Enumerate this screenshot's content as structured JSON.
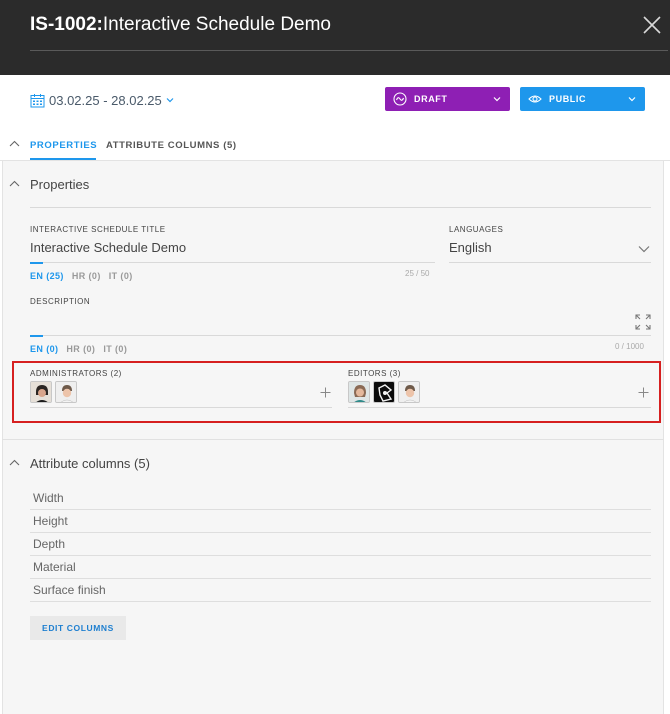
{
  "header": {
    "code": "IS-1002:",
    "title": "Interactive Schedule Demo"
  },
  "date_range": "03.02.25 - 28.02.25",
  "status_pill": {
    "label": "DRAFT",
    "color": "#8e1fb4"
  },
  "visibility_pill": {
    "label": "PUBLIC",
    "color": "#1e97ec"
  },
  "tabs": [
    {
      "label": "PROPERTIES",
      "active": true
    },
    {
      "label": "ATTRIBUTE COLUMNS (5)",
      "active": false
    }
  ],
  "properties": {
    "section_title": "Properties",
    "title_field": {
      "label": "INTERACTIVE SCHEDULE TITLE",
      "value": "Interactive Schedule Demo",
      "counter": "25 / 50",
      "lang_tabs": [
        "EN (25)",
        "HR (0)",
        "IT (0)"
      ]
    },
    "languages_field": {
      "label": "LANGUAGES",
      "value": "English"
    },
    "description_field": {
      "label": "DESCRIPTION",
      "value": "",
      "counter": "0 / 1000",
      "lang_tabs": [
        "EN (0)",
        "HR (0)",
        "IT (0)"
      ]
    },
    "administrators": {
      "label": "ADMINISTRATORS (2)",
      "avatars": [
        "avatar-dark-hair-person",
        "avatar-light-hair-person"
      ]
    },
    "editors": {
      "label": "EDITORS (3)",
      "avatars": [
        "avatar-woman-teal",
        "avatar-logo-black",
        "avatar-light-hair-person"
      ]
    }
  },
  "attribute_columns": {
    "section_title": "Attribute columns (5)",
    "items": [
      "Width",
      "Height",
      "Depth",
      "Material",
      "Surface finish"
    ],
    "edit_button": "EDIT COLUMNS"
  },
  "colors": {
    "accent": "#1e97ec",
    "header_bg": "#2b2b2b",
    "highlight_border": "#d62020"
  }
}
